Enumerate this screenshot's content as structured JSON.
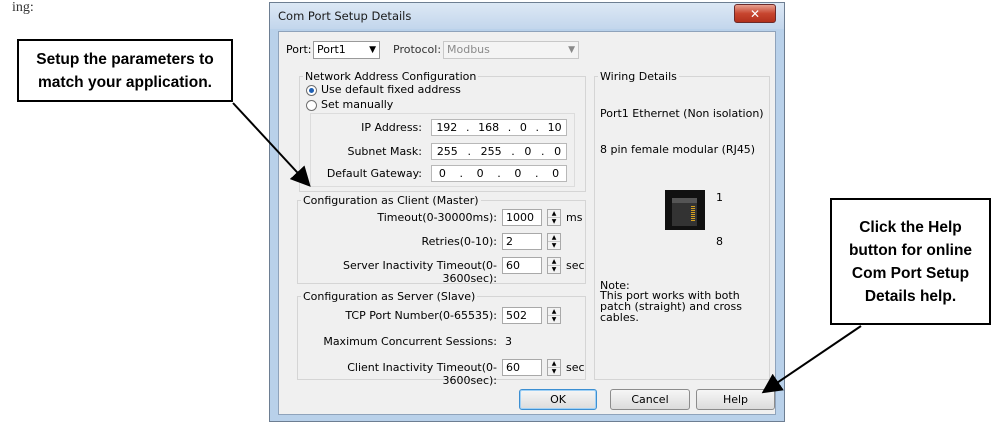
{
  "page": {
    "partial_text": "ing:"
  },
  "callouts": {
    "left": {
      "lines": [
        "Setup the parameters to",
        "match your application."
      ]
    },
    "right": {
      "lines": [
        "Click the Help",
        "button for online",
        "Com Port Setup",
        "Details help."
      ]
    }
  },
  "dialog": {
    "title": "Com Port Setup Details",
    "close_glyph": "✕",
    "port_label": "Port:",
    "port_value": "Port1",
    "protocol_label": "Protocol:",
    "protocol_value": "Modbus",
    "network": {
      "group_label": "Network Address Configuration",
      "radio_default": "Use default fixed address",
      "radio_manual": "Set manually",
      "selected": "default",
      "ip_label": "IP Address:",
      "ip": [
        "192",
        "168",
        "0",
        "10"
      ],
      "mask_label": "Subnet Mask:",
      "mask": [
        "255",
        "255",
        "0",
        "0"
      ],
      "gateway_label": "Default Gateway:",
      "gateway": [
        "0",
        "0",
        "0",
        "0"
      ]
    },
    "client": {
      "group_label": "Configuration as Client (Master)",
      "timeout_label": "Timeout(0-30000ms):",
      "timeout_value": "1000",
      "timeout_unit": "ms",
      "retries_label": "Retries(0-10):",
      "retries_value": "2",
      "server_inactivity_label": "Server Inactivity Timeout(0-3600sec):",
      "server_inactivity_value": "60",
      "server_inactivity_unit": "sec"
    },
    "server": {
      "group_label": "Configuration as Server (Slave)",
      "tcp_label": "TCP Port Number(0-65535):",
      "tcp_value": "502",
      "sessions_label": "Maximum Concurrent Sessions:",
      "sessions_value": "3",
      "client_inactivity_label": "Client Inactivity Timeout(0-3600sec):",
      "client_inactivity_value": "60",
      "client_inactivity_unit": "sec"
    },
    "wiring": {
      "group_label": "Wiring Details",
      "port_desc": "Port1 Ethernet (Non isolation)",
      "connector": "8 pin female modular (RJ45)",
      "pin_first": "1",
      "pin_last": "8",
      "note_title": "Note:",
      "note_text": "This port works with both patch (straight) and cross cables."
    },
    "buttons": {
      "ok": "OK",
      "cancel": "Cancel",
      "help": "Help"
    }
  }
}
